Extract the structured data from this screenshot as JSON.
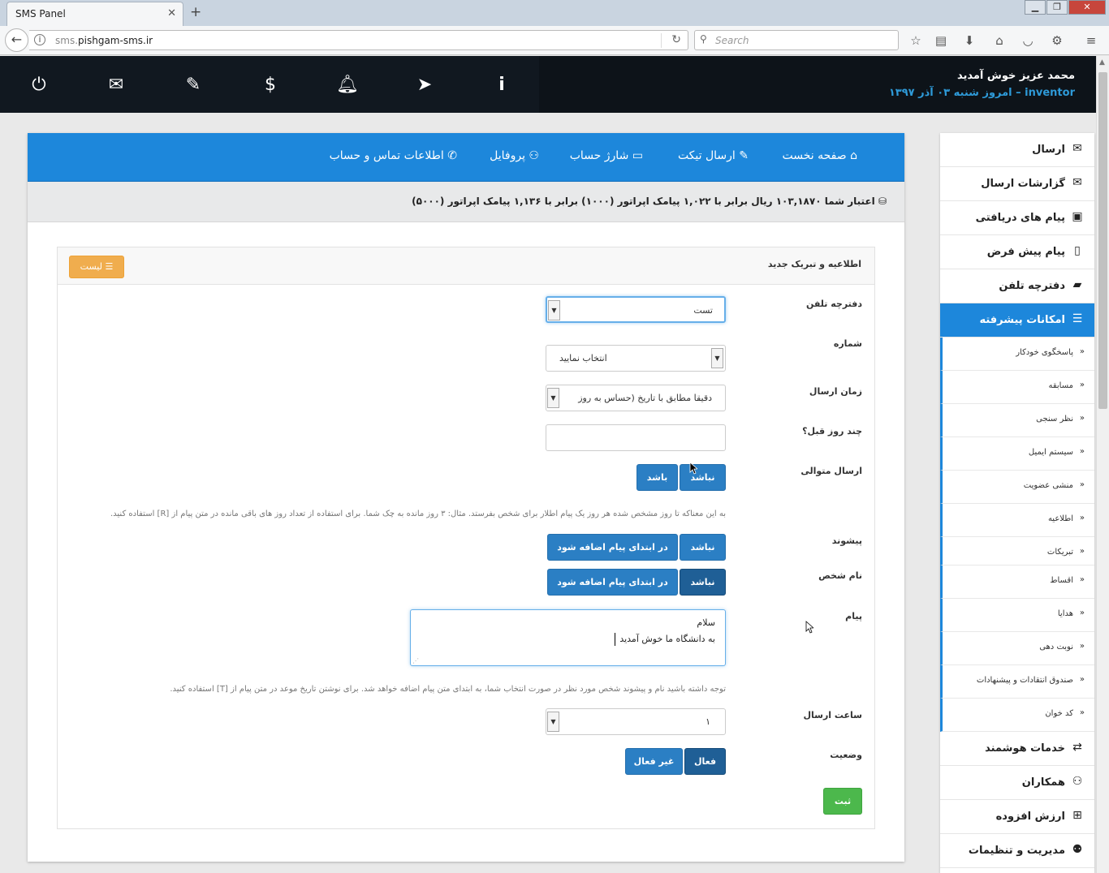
{
  "browser": {
    "tab_title": "SMS Panel",
    "tab_close": "✕",
    "new_tab": "+",
    "url_prefix": "sms.",
    "url_domain": "pishgam-sms.ir",
    "search_placeholder": "Search",
    "window_controls": [
      "▁",
      "❐",
      "✕"
    ]
  },
  "header": {
    "welcome": "محمد عزیز خوش آمدید",
    "username": "inventor",
    "date": "– امروز شنبه ۰۳ آذر ۱۳۹۷",
    "icons": [
      "power-icon",
      "envelope-icon",
      "ticket-icon",
      "dollar-icon",
      "bell-icon",
      "paper-plane-icon",
      "info-icon"
    ]
  },
  "topnav": {
    "home": "صفحه نخست",
    "ticket": "ارسال تیکت",
    "charge": "شارژ حساب",
    "profile": "پروفایل",
    "contact": "اطلاعات تماس و حساب"
  },
  "credit": {
    "text": "اعتبار شما ۱۰۳,۱۸۷۰ ریال برابر با ۱,۰۲۲ پیامک اپراتور (۱۰۰۰) برابر با ۱,۱۳۶ پیامک اپراتور (۵۰۰۰)"
  },
  "form": {
    "title": "اطلاعیه و تبریک جدید",
    "list_button": "لیست",
    "labels": {
      "phonebook": "دفترچه تلفن",
      "number": "شماره",
      "send_time": "زمان ارسال",
      "days_before": "چند روز قبل؟",
      "consecutive": "ارسال متوالی",
      "prefix": "پیشوند",
      "person_name": "نام شخص",
      "message": "پیام",
      "send_hour": "ساعت ارسال",
      "status": "وضعیت"
    },
    "phonebook_value": "تست",
    "number_value": "انتخاب نمایید",
    "send_time_value": "دقیقا مطابق با تاریخ (حساس به روز",
    "days_before_value": "",
    "consecutive": {
      "no": "نباشد",
      "yes": "باشد"
    },
    "hint_consecutive": "به این معناکه تا روز مشخص شده هر روز یک پیام اطلار برای شخص بفرستد. مثال: ۳ روز مانده به چک شما. برای استفاده از تعداد روز های باقی مانده در متن پیام از [R] استفاده کنید.",
    "prefix": {
      "no": "نباشد",
      "yes": "در ابتدای پیام اضافه شود"
    },
    "person_name": {
      "no": "نباشد",
      "yes": "در ابتدای پیام اضافه شود"
    },
    "message_line1": "سلام",
    "message_line2": "به دانشگاه ما خوش آمدید",
    "hint_message": "توجه داشته باشید نام و پیشوند شخص مورد نظر در صورت انتخاب شما، به ابتدای متن پیام اضافه خواهد شد. برای نوشتن تاریخ موعد در متن پیام از [T] استفاده کنید.",
    "send_hour_value": "۱",
    "status": {
      "active": "فعال",
      "inactive": "غیر فعال"
    },
    "submit": "ثبت"
  },
  "sidebar": {
    "items": [
      {
        "label": "ارسال",
        "icon": "envelope-icon",
        "glyph": "✉"
      },
      {
        "label": "گزارشات ارسال",
        "icon": "envelope-outline-icon",
        "glyph": "✉"
      },
      {
        "label": "پیام های دریافتی",
        "icon": "inbox-icon",
        "glyph": "▣"
      },
      {
        "label": "پیام پیش فرض",
        "icon": "file-icon",
        "glyph": "▯"
      },
      {
        "label": "دفترچه تلفن",
        "icon": "book-icon",
        "glyph": "▰"
      },
      {
        "label": "امکانات پیشرفته",
        "icon": "list-icon",
        "glyph": "☰"
      }
    ],
    "subitems": [
      "پاسخگوی خودکار",
      "مسابقه",
      "نظر سنجی",
      "سیستم ایمیل",
      "منشی عضویت",
      "اطلاعیه",
      "تبریکات",
      "اقساط",
      "هدایا",
      "نوبت دهی",
      "صندوق انتقادات و پیشنهادات",
      "کد خوان"
    ],
    "bottom_items": [
      {
        "label": "خدمات هوشمند",
        "icon": "retweet-icon",
        "glyph": "⇄"
      },
      {
        "label": "همکاران",
        "icon": "users-icon",
        "glyph": "⚇"
      },
      {
        "label": "ارزش افزوده",
        "icon": "plus-square-icon",
        "glyph": "⊞"
      },
      {
        "label": "مدیریت و تنظیمات",
        "icon": "group-icon",
        "glyph": "⚉"
      }
    ]
  },
  "colors": {
    "header_bg": "#111820",
    "nav_blue": "#1d87db",
    "button_blue": "#2b7fc4",
    "button_dark": "#1f5f96",
    "submit_green": "#4cb84c",
    "list_orange": "#f0ad4e",
    "date_blue": "#2e9ad8"
  }
}
